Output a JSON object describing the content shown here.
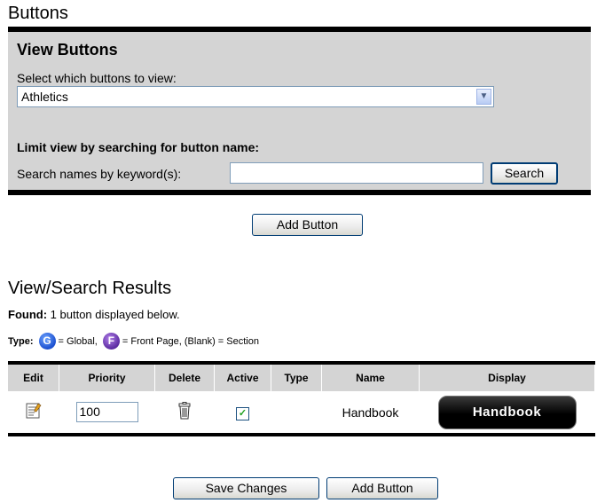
{
  "page_title": "Buttons",
  "view_panel": {
    "title": "View Buttons",
    "select_label": "Select which buttons to view:",
    "selected_value": "Athletics",
    "limit_heading": "Limit view by searching for button name:",
    "search_label": "Search names by keyword(s):",
    "search_value": "",
    "search_button": "Search"
  },
  "add_button_top": "Add Button",
  "results": {
    "title": "View/Search Results",
    "found_label": "Found:",
    "found_text": "1 button displayed below.",
    "type_label": "Type:",
    "global_letter": "G",
    "global_text": "= Global,",
    "front_letter": "F",
    "front_text": "= Front Page, (Blank) = Section",
    "headers": [
      "Edit",
      "Priority",
      "Delete",
      "Active",
      "Type",
      "Name",
      "Display"
    ],
    "rows": [
      {
        "priority": "100",
        "active": true,
        "type": "",
        "name": "Handbook",
        "display": "Handbook"
      }
    ]
  },
  "bottom_buttons": {
    "save": "Save Changes",
    "add": "Add Button"
  }
}
